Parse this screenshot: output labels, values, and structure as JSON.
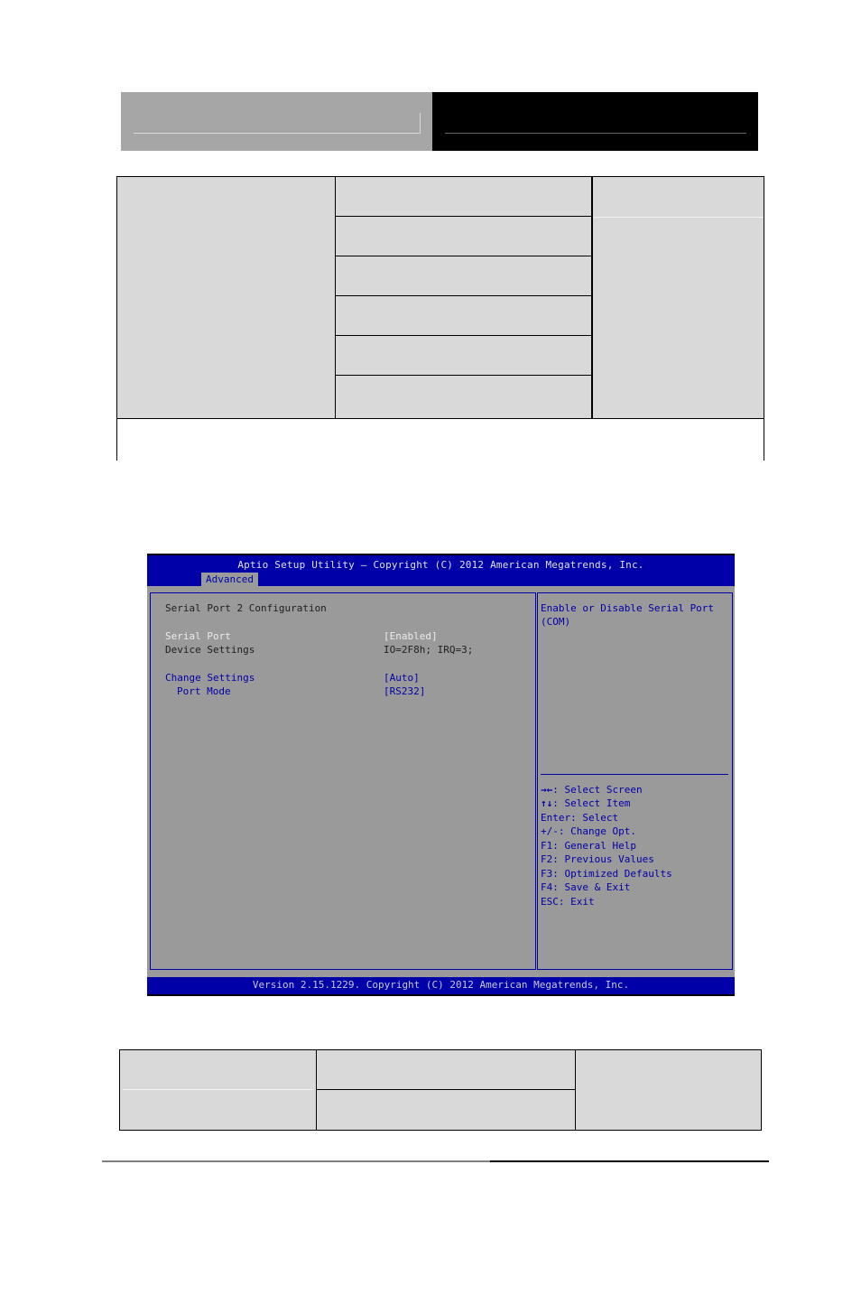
{
  "bios": {
    "title": "Aptio Setup Utility – Copyright (C) 2012 American Megatrends, Inc.",
    "active_tab": "Advanced",
    "section_title": "Serial Port 2 Configuration",
    "settings": [
      {
        "label": "Serial Port",
        "value": "[Enabled]",
        "state": "selected"
      },
      {
        "label": "Device Settings",
        "value": "IO=2F8h; IRQ=3;",
        "state": "readonly"
      },
      {
        "label": "Change Settings",
        "value": "[Auto]",
        "state": "option"
      },
      {
        "label": "Port Mode",
        "value": "[RS232]",
        "state": "option"
      }
    ],
    "help_text": [
      "Enable or Disable Serial Port",
      "(COM)"
    ],
    "key_help": [
      {
        "key": "→←",
        "action": ": Select Screen"
      },
      {
        "key": "↑↓",
        "action": ": Select Item"
      },
      {
        "key": "Enter",
        "action": ": Select"
      },
      {
        "key": "+/-",
        "action": ": Change Opt."
      },
      {
        "key": "F1",
        "action": ": General Help"
      },
      {
        "key": "F2",
        "action": ": Previous Values"
      },
      {
        "key": "F3",
        "action": ": Optimized Defaults"
      },
      {
        "key": "F4",
        "action": ": Save & Exit"
      },
      {
        "key": "ESC",
        "action": ": Exit"
      }
    ],
    "footer": "Version 2.15.1229. Copyright (C) 2012 American Megatrends, Inc.",
    "colors": {
      "title_bar": "#0000a8",
      "panel_bg": "#9a9a9a",
      "selected_text": "#ececec",
      "option_text": "#0000a8"
    }
  },
  "page": {
    "header_colors": {
      "left": "#a6a6a6",
      "right": "#000000"
    },
    "table_fill": "#d9d9d9"
  }
}
